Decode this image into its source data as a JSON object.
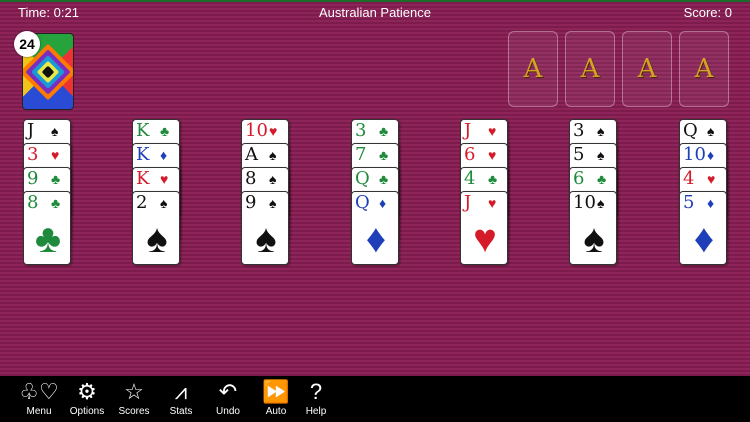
{
  "header": {
    "time": "Time: 0:21",
    "title": "Australian Patience",
    "score": "Score: 0"
  },
  "stock": {
    "count": "24"
  },
  "foundations": [
    {
      "label": "A"
    },
    {
      "label": "A"
    },
    {
      "label": "A"
    },
    {
      "label": "A"
    }
  ],
  "tableau": [
    {
      "cards": [
        {
          "rank": "J",
          "suit": "♠",
          "color": "black"
        },
        {
          "rank": "3",
          "suit": "♥",
          "color": "red"
        },
        {
          "rank": "9",
          "suit": "♣",
          "color": "green"
        },
        {
          "rank": "8",
          "suit": "♣",
          "color": "green"
        }
      ]
    },
    {
      "cards": [
        {
          "rank": "K",
          "suit": "♣",
          "color": "green"
        },
        {
          "rank": "K",
          "suit": "♦",
          "color": "blue"
        },
        {
          "rank": "K",
          "suit": "♥",
          "color": "red"
        },
        {
          "rank": "2",
          "suit": "♠",
          "color": "black"
        }
      ]
    },
    {
      "cards": [
        {
          "rank": "10",
          "suit": "♥",
          "color": "red"
        },
        {
          "rank": "A",
          "suit": "♠",
          "color": "black"
        },
        {
          "rank": "8",
          "suit": "♠",
          "color": "black"
        },
        {
          "rank": "9",
          "suit": "♠",
          "color": "black"
        }
      ]
    },
    {
      "cards": [
        {
          "rank": "3",
          "suit": "♣",
          "color": "green"
        },
        {
          "rank": "7",
          "suit": "♣",
          "color": "green"
        },
        {
          "rank": "Q",
          "suit": "♣",
          "color": "green"
        },
        {
          "rank": "Q",
          "suit": "♦",
          "color": "blue"
        }
      ]
    },
    {
      "cards": [
        {
          "rank": "J",
          "suit": "♥",
          "color": "red"
        },
        {
          "rank": "6",
          "suit": "♥",
          "color": "red"
        },
        {
          "rank": "4",
          "suit": "♣",
          "color": "green"
        },
        {
          "rank": "J",
          "suit": "♥",
          "color": "red"
        }
      ]
    },
    {
      "cards": [
        {
          "rank": "3",
          "suit": "♠",
          "color": "black"
        },
        {
          "rank": "5",
          "suit": "♠",
          "color": "black"
        },
        {
          "rank": "6",
          "suit": "♣",
          "color": "green"
        },
        {
          "rank": "10",
          "suit": "♠",
          "color": "black"
        }
      ]
    },
    {
      "cards": [
        {
          "rank": "Q",
          "suit": "♠",
          "color": "black"
        },
        {
          "rank": "10",
          "suit": "♦",
          "color": "blue"
        },
        {
          "rank": "4",
          "suit": "♥",
          "color": "red"
        },
        {
          "rank": "5",
          "suit": "♦",
          "color": "blue"
        }
      ]
    }
  ],
  "toolbar": [
    {
      "label": "Menu",
      "icon": "card-suits-icon",
      "glyph": "♧♡"
    },
    {
      "label": "Options",
      "icon": "gears-icon",
      "glyph": "⚙"
    },
    {
      "label": "Scores",
      "icon": "star-icon",
      "glyph": "☆"
    },
    {
      "label": "Stats",
      "icon": "chart-icon",
      "glyph": "⩘"
    },
    {
      "label": "Undo",
      "icon": "undo-icon",
      "glyph": "↶"
    },
    {
      "label": "Auto",
      "icon": "fast-forward-icon",
      "glyph": "⏩"
    },
    {
      "label": "Help",
      "icon": "help-icon",
      "glyph": "?"
    }
  ],
  "colors": {
    "felt": "#8a1e55",
    "red": "#d51b2a",
    "black": "#111111",
    "blue": "#1e3fb8",
    "green": "#1f8a3b",
    "ace_gold": "#d6a02a"
  }
}
